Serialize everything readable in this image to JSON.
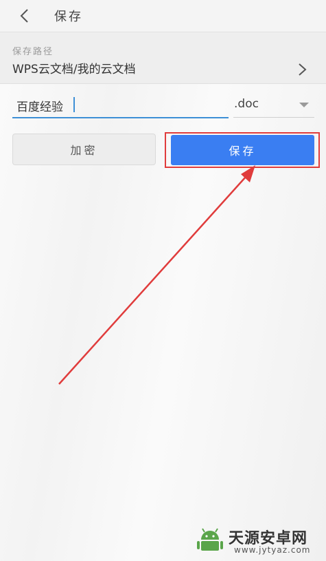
{
  "header": {
    "title": "保存"
  },
  "path": {
    "label": "保存路径",
    "value": "WPS云文档/我的云文档"
  },
  "filename": {
    "value": "百度经验"
  },
  "extension": {
    "selected": ".doc"
  },
  "buttons": {
    "encrypt": "加密",
    "save": "保存"
  },
  "watermark": {
    "name": "天源安卓网",
    "url": "www.jytyaz.com"
  },
  "colors": {
    "accent": "#3a7ef2",
    "input_underline": "#3d8fd6",
    "annotation": "#e03c3c",
    "logo_green": "#5aa54a"
  },
  "icons": {
    "back": "chevron-left-icon",
    "path": "chevron-right-icon",
    "extension": "triangle-down-icon"
  }
}
